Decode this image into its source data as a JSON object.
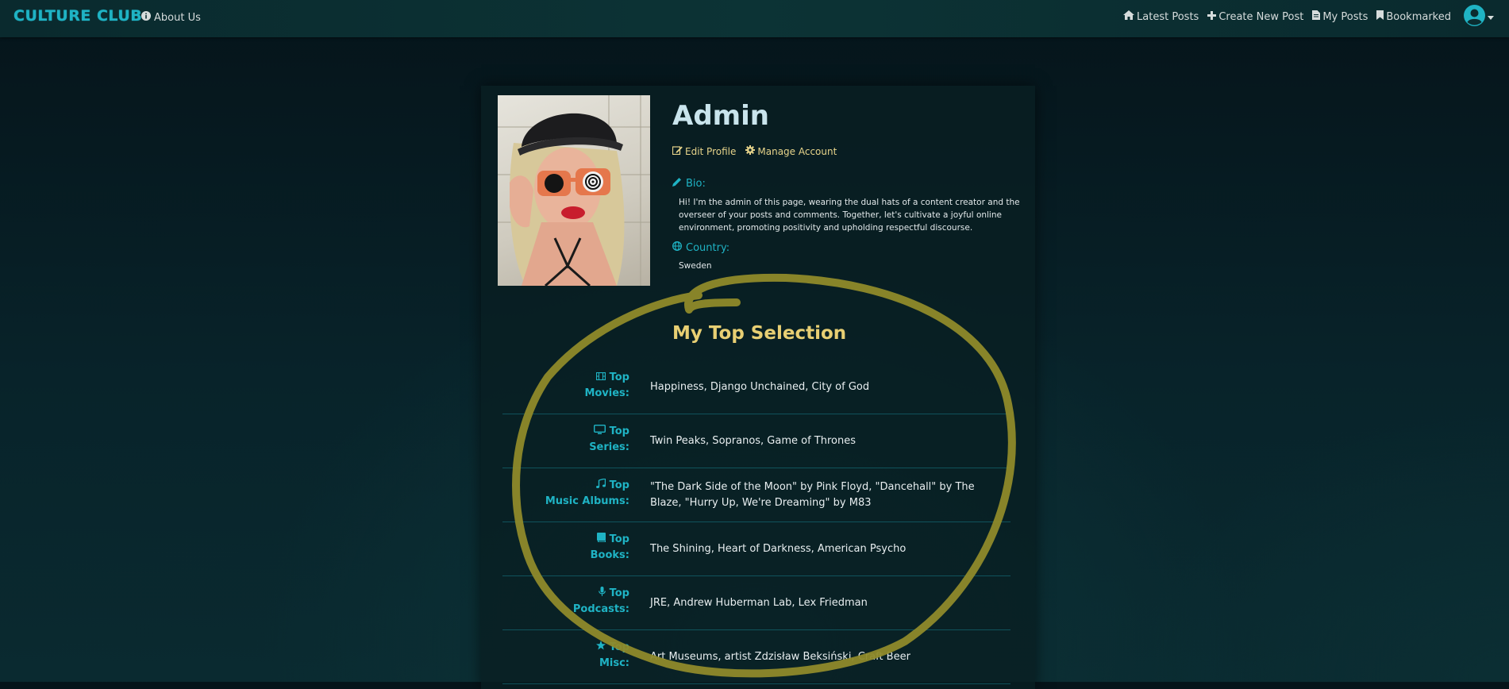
{
  "navbar": {
    "brand": "CULTURE CLUB",
    "about_label": "About Us",
    "links": [
      {
        "label": "Latest Posts",
        "icon": "home-icon"
      },
      {
        "label": "Create New Post",
        "icon": "plus-icon"
      },
      {
        "label": "My Posts",
        "icon": "document-icon"
      },
      {
        "label": "Bookmarked",
        "icon": "bookmark-icon"
      }
    ],
    "avatar_icon": "user-circle-icon"
  },
  "profile": {
    "name": "Admin",
    "edit_label": "Edit Profile",
    "manage_label": "Manage Account",
    "bio_label": "Bio:",
    "bio": "Hi! I'm the admin of this page, wearing the dual hats of a content creator and the overseer of your posts and comments. Together, let's cultivate a joyful online environment, promoting positivity and upholding respectful discourse.",
    "country_label": "Country:",
    "country": "Sweden"
  },
  "top_selection": {
    "title": "My Top Selection",
    "rows": [
      {
        "label_1": "Top",
        "label_2": "Movies:",
        "icon": "film-icon",
        "value": "Happiness, Django Unchained, City of God"
      },
      {
        "label_1": "Top",
        "label_2": "Series:",
        "icon": "tv-icon",
        "value": "Twin Peaks, Sopranos, Game of Thrones"
      },
      {
        "label_1": "Top",
        "label_2": "Music Albums:",
        "icon": "music-icon",
        "value": "\"The Dark Side of the Moon\" by Pink Floyd, \"Dancehall\" by The Blaze, \"Hurry Up, We're Dreaming\" by M83"
      },
      {
        "label_1": "Top",
        "label_2": "Books:",
        "icon": "book-icon",
        "value": "The Shining, Heart of Darkness, American Psycho"
      },
      {
        "label_1": "Top",
        "label_2": "Podcasts:",
        "icon": "microphone-icon",
        "value": "JRE, Andrew Huberman Lab, Lex Friedman"
      },
      {
        "label_1": "Top",
        "label_2": "Misc:",
        "icon": "star-icon",
        "value": "Art Museums, artist Zdzisław Beksiński, Craft Beer"
      }
    ]
  },
  "colors": {
    "accent_teal": "#1fb3c4",
    "accent_gold": "#e8cf73",
    "annotation": "#8f8a2a"
  }
}
